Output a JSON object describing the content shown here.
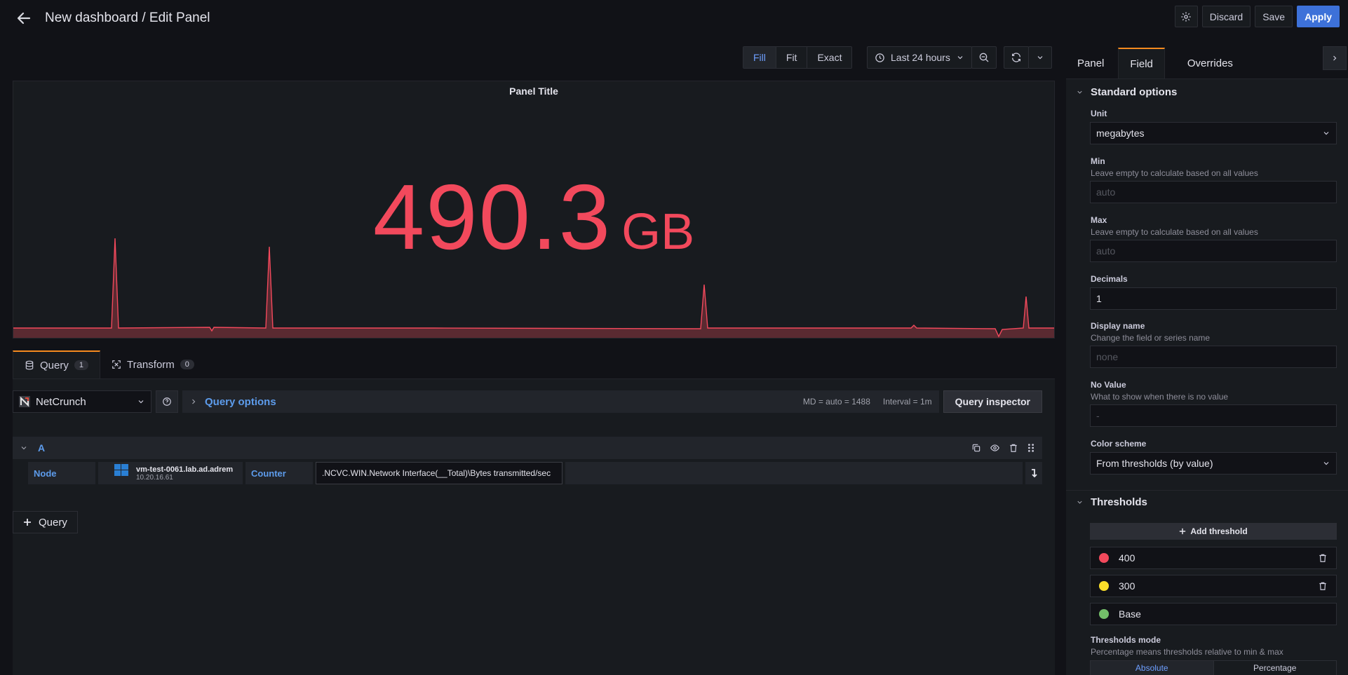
{
  "header": {
    "title": "New dashboard / Edit Panel",
    "discard_label": "Discard",
    "save_label": "Save",
    "apply_label": "Apply"
  },
  "toolbar": {
    "view_modes": [
      "Fill",
      "Fit",
      "Exact"
    ],
    "active_view_mode": "Fill",
    "time_range": "Last 24 hours"
  },
  "panel": {
    "title": "Panel Title",
    "stat_value": "490.3",
    "stat_unit": "GB",
    "color": "#f2495c"
  },
  "query_tabs": [
    {
      "label": "Query",
      "count": "1"
    },
    {
      "label": "Transform",
      "count": "0"
    }
  ],
  "query": {
    "datasource": "NetCrunch",
    "options_label": "Query options",
    "md": "MD = auto = 1488",
    "interval": "Interval = 1m",
    "inspector_label": "Query inspector",
    "ref_id": "A",
    "node_label": "Node",
    "node_name": "vm-test-0061.lab.ad.adrem",
    "node_ip": "10.20.16.61",
    "node_os": "WIN",
    "counter_label": "Counter",
    "counter_value": ".NCVC.WIN.Network Interface(__Total)\\Bytes transmitted/sec",
    "add_query_label": "Query"
  },
  "sidebar": {
    "tabs": [
      "Panel",
      "Field",
      "Overrides"
    ],
    "active_tab": "Field",
    "standard_options": {
      "heading": "Standard options",
      "unit_label": "Unit",
      "unit_value": "megabytes",
      "min_label": "Min",
      "min_desc": "Leave empty to calculate based on all values",
      "min_placeholder": "auto",
      "max_label": "Max",
      "max_desc": "Leave empty to calculate based on all values",
      "max_placeholder": "auto",
      "decimals_label": "Decimals",
      "decimals_value": "1",
      "display_name_label": "Display name",
      "display_name_desc": "Change the field or series name",
      "display_name_placeholder": "none",
      "no_value_label": "No Value",
      "no_value_desc": "What to show when there is no value",
      "no_value_placeholder": "-",
      "color_scheme_label": "Color scheme",
      "color_scheme_value": "From thresholds (by value)"
    },
    "thresholds": {
      "heading": "Thresholds",
      "add_label": "Add threshold",
      "items": [
        {
          "value": "400",
          "color": "#f2495c"
        },
        {
          "value": "300",
          "color": "#fade2a"
        },
        {
          "value": "Base",
          "color": "#73bf69"
        }
      ],
      "mode_label": "Thresholds mode",
      "mode_desc": "Percentage means thresholds relative to min & max",
      "modes": [
        "Absolute",
        "Percentage"
      ],
      "active_mode": "Absolute"
    }
  }
}
